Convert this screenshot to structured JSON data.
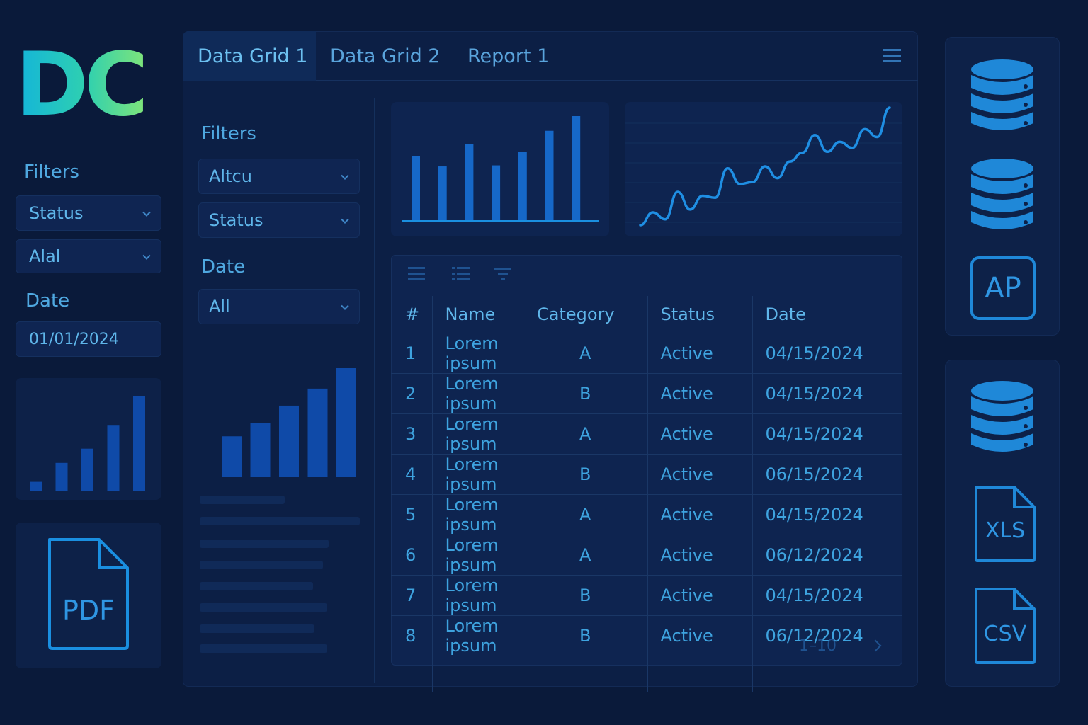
{
  "logo": "DC",
  "left_sidebar": {
    "filters_label": "Filters",
    "status_select": "Status",
    "alal_select": "Alal",
    "date_label": "Date",
    "date_value": "01/01/2024",
    "mini_chart": {
      "values": [
        1,
        3,
        4.5,
        7,
        10
      ]
    },
    "pdf_label": "PDF"
  },
  "tabs": [
    "Data Grid 1",
    "Data Grid 2",
    "Report 1"
  ],
  "inner_filters": {
    "filters_label": "Filters",
    "altcu_select": "Altcu",
    "status_select": "Status",
    "date_label": "Date",
    "date_select": "All",
    "mini_chart": {
      "values": [
        6,
        8,
        10.5,
        13,
        16
      ]
    }
  },
  "chart_data": [
    {
      "type": "bar",
      "values": [
        6.2,
        5.2,
        7.3,
        5.3,
        6.6,
        8.6,
        10
      ]
    },
    {
      "type": "line",
      "values": [
        0,
        1.3,
        0.6,
        3.4,
        1.6,
        3.0,
        2.8,
        5.8,
        4.2,
        4.4,
        6.0,
        4.8,
        6.5,
        7.4,
        9.2,
        7.5,
        8.5,
        7.9,
        9.8,
        9.0,
        12
      ]
    }
  ],
  "table": {
    "headers": [
      "#",
      "Name",
      "Category",
      "Status",
      "Date"
    ],
    "rows": [
      [
        "1",
        "Lorem ipsum",
        "A",
        "Active",
        "04/15/2024"
      ],
      [
        "2",
        "Lorem ipsum",
        "B",
        "Active",
        "04/15/2024"
      ],
      [
        "3",
        "Lorem ipsum",
        "A",
        "Active",
        "04/15/2024"
      ],
      [
        "4",
        "Lorem ipsum",
        "B",
        "Active",
        "06/15/2024"
      ],
      [
        "5",
        "Lorem ipsum",
        "A",
        "Active",
        "04/15/2024"
      ],
      [
        "6",
        "Lorem ipsum",
        "A",
        "Active",
        "06/12/2024"
      ],
      [
        "7",
        "Lorem ipsum",
        "B",
        "Active",
        "04/15/2024"
      ],
      [
        "8",
        "Lorem ipsum",
        "B",
        "Active",
        "06/12/2024"
      ]
    ],
    "pagination": "1–10"
  },
  "right_sidebar": {
    "api_label": "AP",
    "xls_label": "XLS",
    "csv_label": "CSV"
  },
  "colors": {
    "background": "#0a1a3a",
    "panel": "#0d2148",
    "accent": "#1a8fe0",
    "bar": "#0f4aa8"
  }
}
